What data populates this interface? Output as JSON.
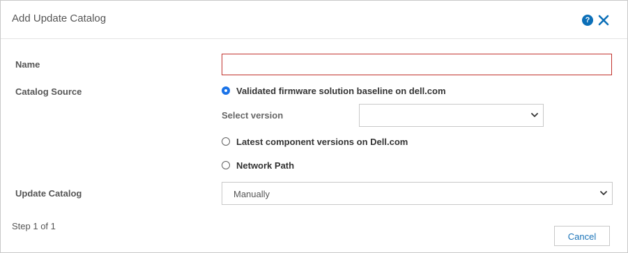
{
  "dialog": {
    "title": "Add Update Catalog",
    "help_icon": "question-circle-icon",
    "close_icon": "close-x-icon",
    "accent_color": "#0b6fb8"
  },
  "form": {
    "name_label": "Name",
    "name_value": "",
    "catalog_source_label": "Catalog Source",
    "catalog_source_options": [
      {
        "label": "Validated firmware solution baseline on dell.com",
        "selected": true
      },
      {
        "label": "Latest component versions on Dell.com",
        "selected": false
      },
      {
        "label": "Network Path",
        "selected": false
      }
    ],
    "select_version_label": "Select version",
    "select_version_value": "",
    "update_catalog_label": "Update Catalog",
    "update_catalog_value": "Manually"
  },
  "footer": {
    "step_text": "Step 1 of 1",
    "cancel_label": "Cancel"
  }
}
